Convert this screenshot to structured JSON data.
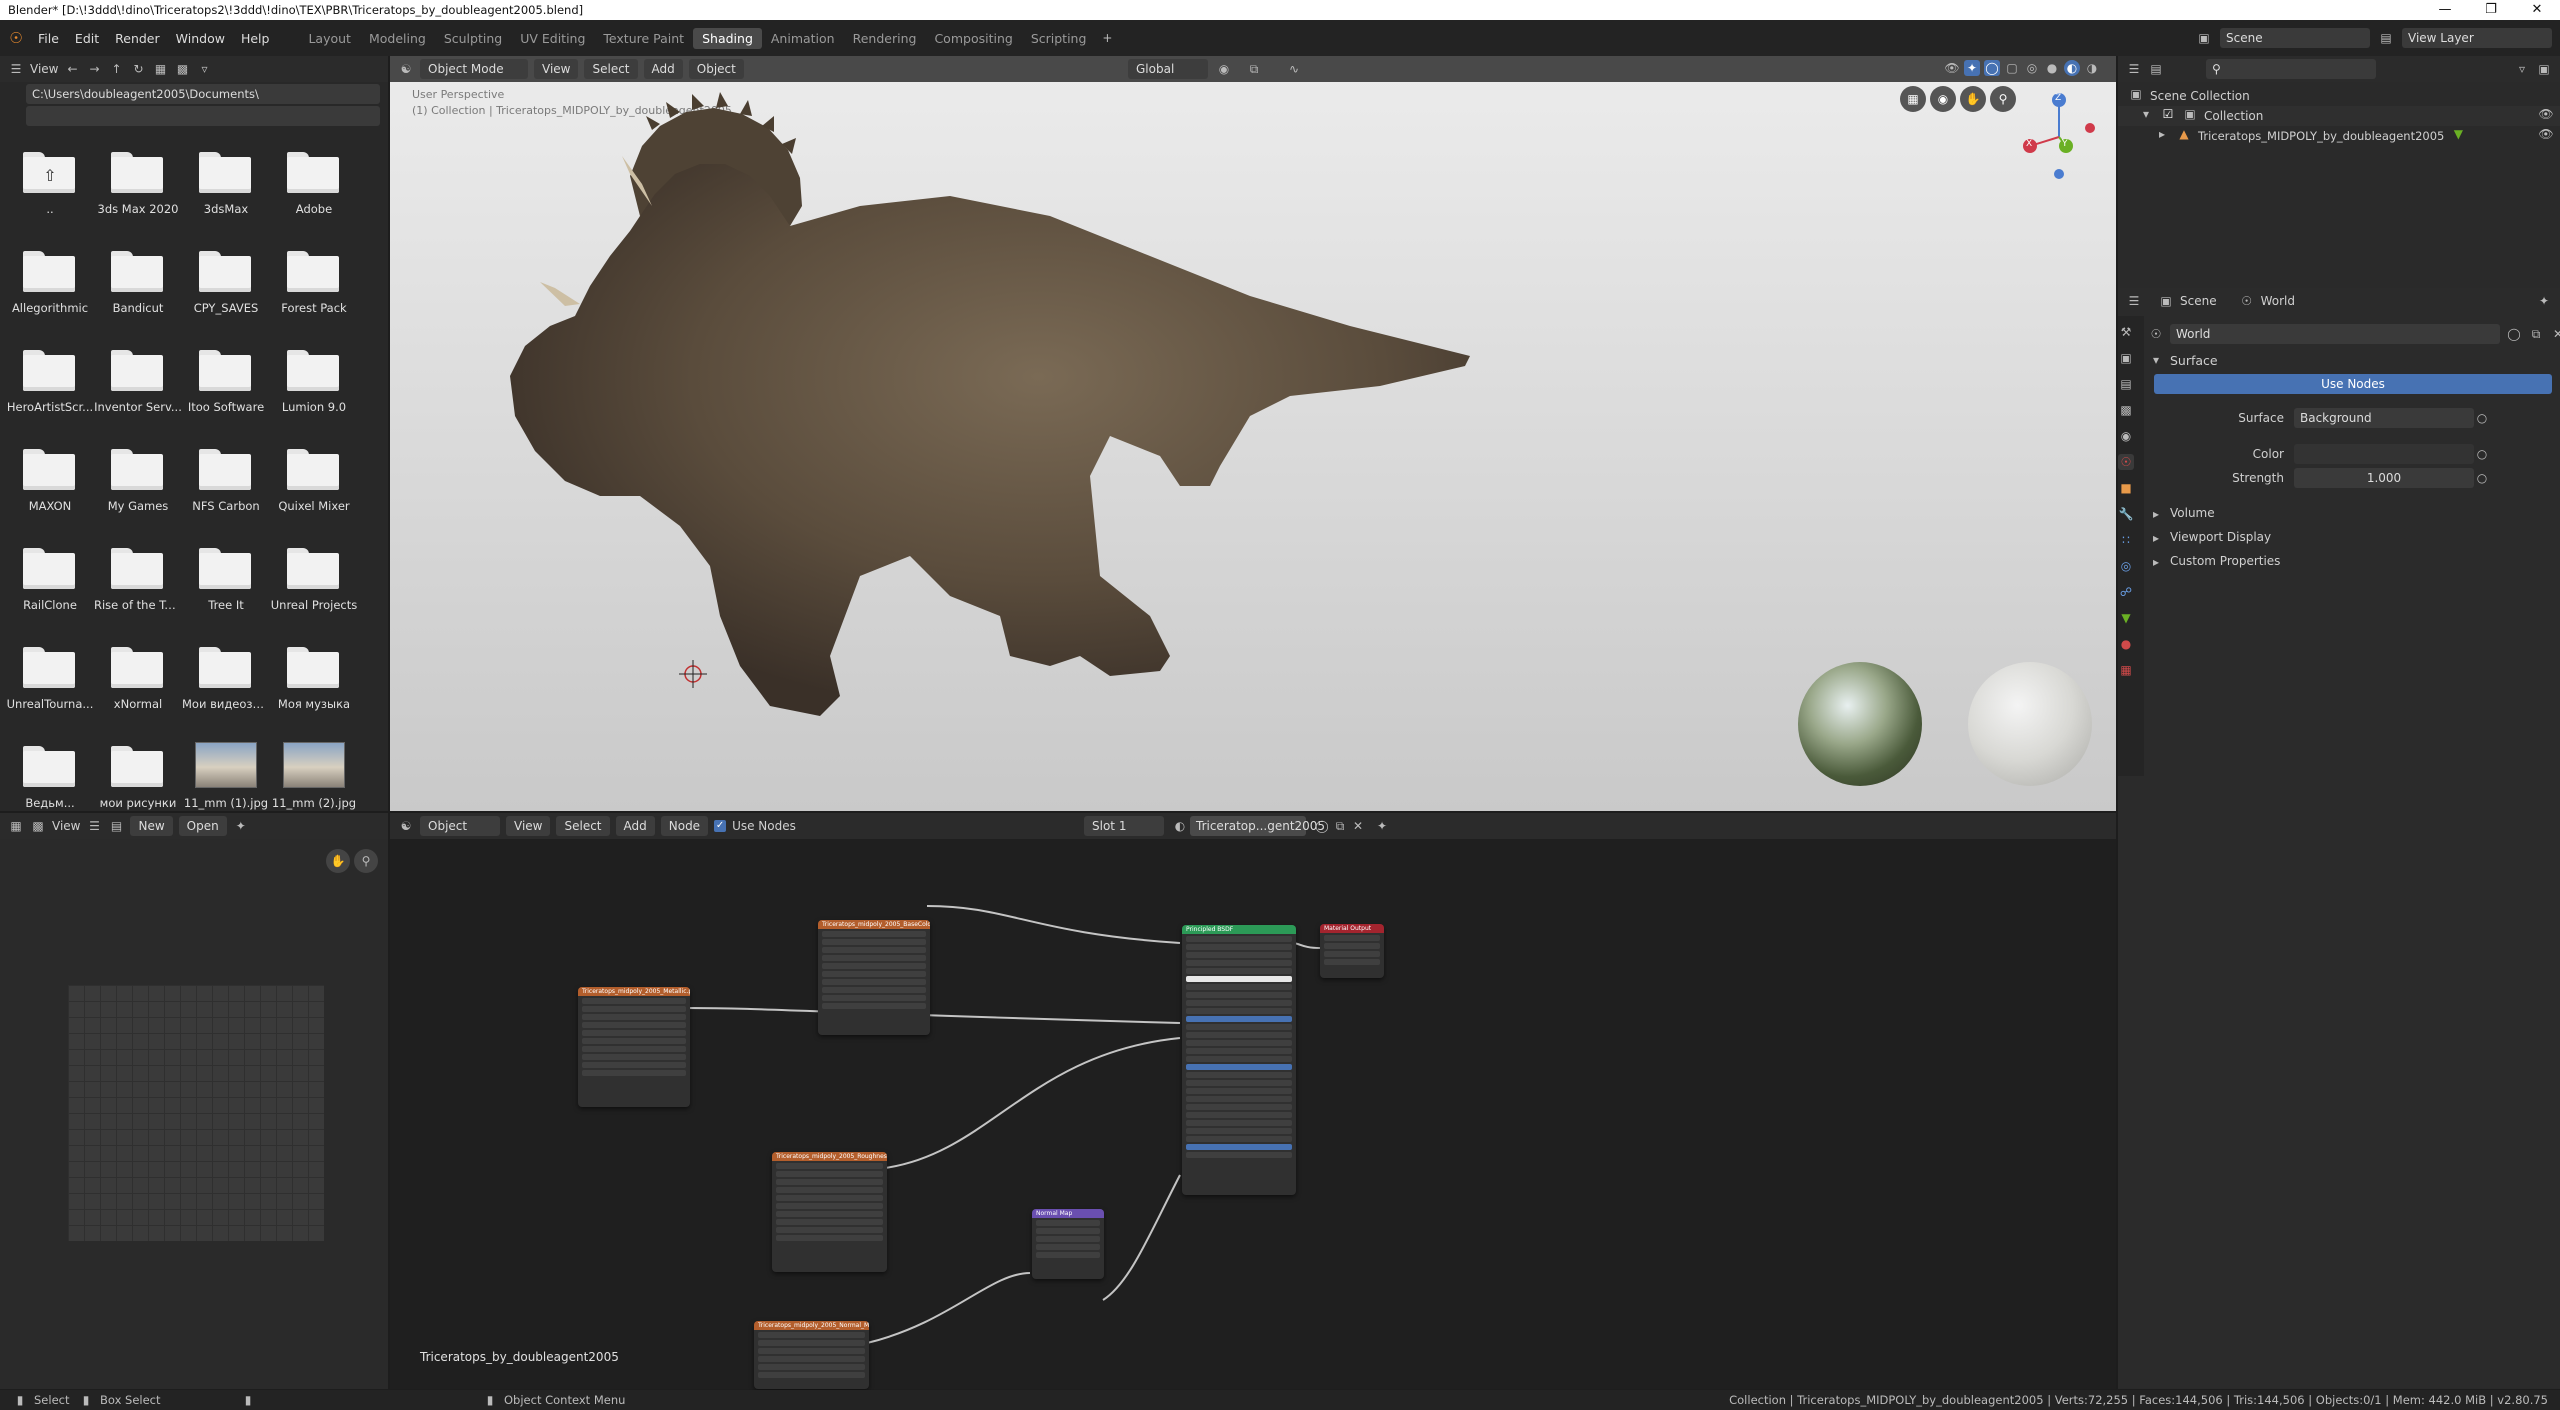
{
  "window": {
    "title": "Blender* [D:\\!3ddd\\!dino\\Triceratops2\\!3ddd\\!dino\\TEX\\PBR\\Triceratops_by_doubleagent2005.blend]"
  },
  "menu": {
    "items": [
      "File",
      "Edit",
      "Render",
      "Window",
      "Help"
    ]
  },
  "workspaces": [
    "Layout",
    "Modeling",
    "Sculpting",
    "UV Editing",
    "Texture Paint",
    "Shading",
    "Animation",
    "Rendering",
    "Compositing",
    "Scripting"
  ],
  "active_workspace": "Shading",
  "top_right": {
    "scene": "Scene",
    "view_layer": "View Layer"
  },
  "file_browser": {
    "view_label": "View",
    "path": "C:\\Users\\doubleagent2005\\Documents\\",
    "items": [
      {
        "label": ".."
      },
      {
        "label": "3ds Max 2020"
      },
      {
        "label": "3dsMax"
      },
      {
        "label": "Adobe"
      },
      {
        "label": "Allegorithmic"
      },
      {
        "label": "Bandicut"
      },
      {
        "label": "CPY_SAVES"
      },
      {
        "label": "Forest Pack"
      },
      {
        "label": "HeroArtistScr..."
      },
      {
        "label": "Inventor Serv..."
      },
      {
        "label": "Itoo Software"
      },
      {
        "label": "Lumion 9.0"
      },
      {
        "label": "MAXON"
      },
      {
        "label": "My Games"
      },
      {
        "label": "NFS Carbon"
      },
      {
        "label": "Quixel Mixer"
      },
      {
        "label": "RailClone"
      },
      {
        "label": "Rise of the To..."
      },
      {
        "label": "Tree It"
      },
      {
        "label": "Unreal Projects"
      },
      {
        "label": "UnrealTourna..."
      },
      {
        "label": "xNormal"
      },
      {
        "label": "Мои видеоза..."
      },
      {
        "label": "Моя музыка"
      },
      {
        "label": "Ведьм..."
      },
      {
        "label": "мои рисунки"
      },
      {
        "label": "11_mm (1).jpg"
      },
      {
        "label": "11_mm (2).jpg"
      }
    ]
  },
  "viewport": {
    "mode": "Object Mode",
    "menus": [
      "View",
      "Select",
      "Add",
      "Object"
    ],
    "orientation": "Global",
    "overlay_title": "User Perspective",
    "overlay_subtitle": "(1) Collection | Triceratops_MIDPOLY_by_doubleagent2005",
    "gizmo": {
      "x": "X",
      "y": "Y",
      "z": "Z"
    }
  },
  "image_editor": {
    "view": "View",
    "new": "New",
    "open": "Open"
  },
  "node_editor": {
    "type": "Object",
    "menus": [
      "View",
      "Select",
      "Add",
      "Node"
    ],
    "use_nodes_label": "Use Nodes",
    "slot": "Slot 1",
    "material": "Triceratop...gent2005",
    "footer_label": "Triceratops_by_doubleagent2005",
    "nodes": [
      {
        "title": "Triceratops_midpoly_2005_BaseColor",
        "color": "#b35e2c"
      },
      {
        "title": "Triceratops_midpoly_2005_Metallic.pn",
        "color": "#b35e2c"
      },
      {
        "title": "Triceratops_midpoly_2005_Roughness",
        "color": "#b35e2c"
      },
      {
        "title": "Normal Map",
        "color": "#6a4fb0"
      },
      {
        "title": "Triceratops_midpoly_2005_Normal_Map",
        "color": "#b35e2c"
      },
      {
        "title": "Principled BSDF",
        "color": "#2c9a57"
      },
      {
        "title": "Material Output",
        "color": "#a3242e"
      }
    ]
  },
  "outliner": {
    "root": "Scene Collection",
    "collection": "Collection",
    "object": "Triceratops_MIDPOLY_by_doubleagent2005"
  },
  "properties": {
    "scene_tab": "Scene",
    "world_tab": "World",
    "world_name": "World",
    "surface_panel": "Surface",
    "use_nodes_button": "Use Nodes",
    "surface_label": "Surface",
    "surface_value": "Background",
    "color_label": "Color",
    "strength_label": "Strength",
    "strength_value": "1.000",
    "panels": [
      "Volume",
      "Viewport Display",
      "Custom Properties"
    ]
  },
  "statusbar": {
    "select": "Select",
    "box_select": "Box Select",
    "context_menu": "Object Context Menu",
    "stats": "Collection | Triceratops_MIDPOLY_by_doubleagent2005 | Verts:72,255 | Faces:144,506 | Tris:144,506 | Objects:0/1 | Mem: 442.0 MiB | v2.80.75"
  }
}
